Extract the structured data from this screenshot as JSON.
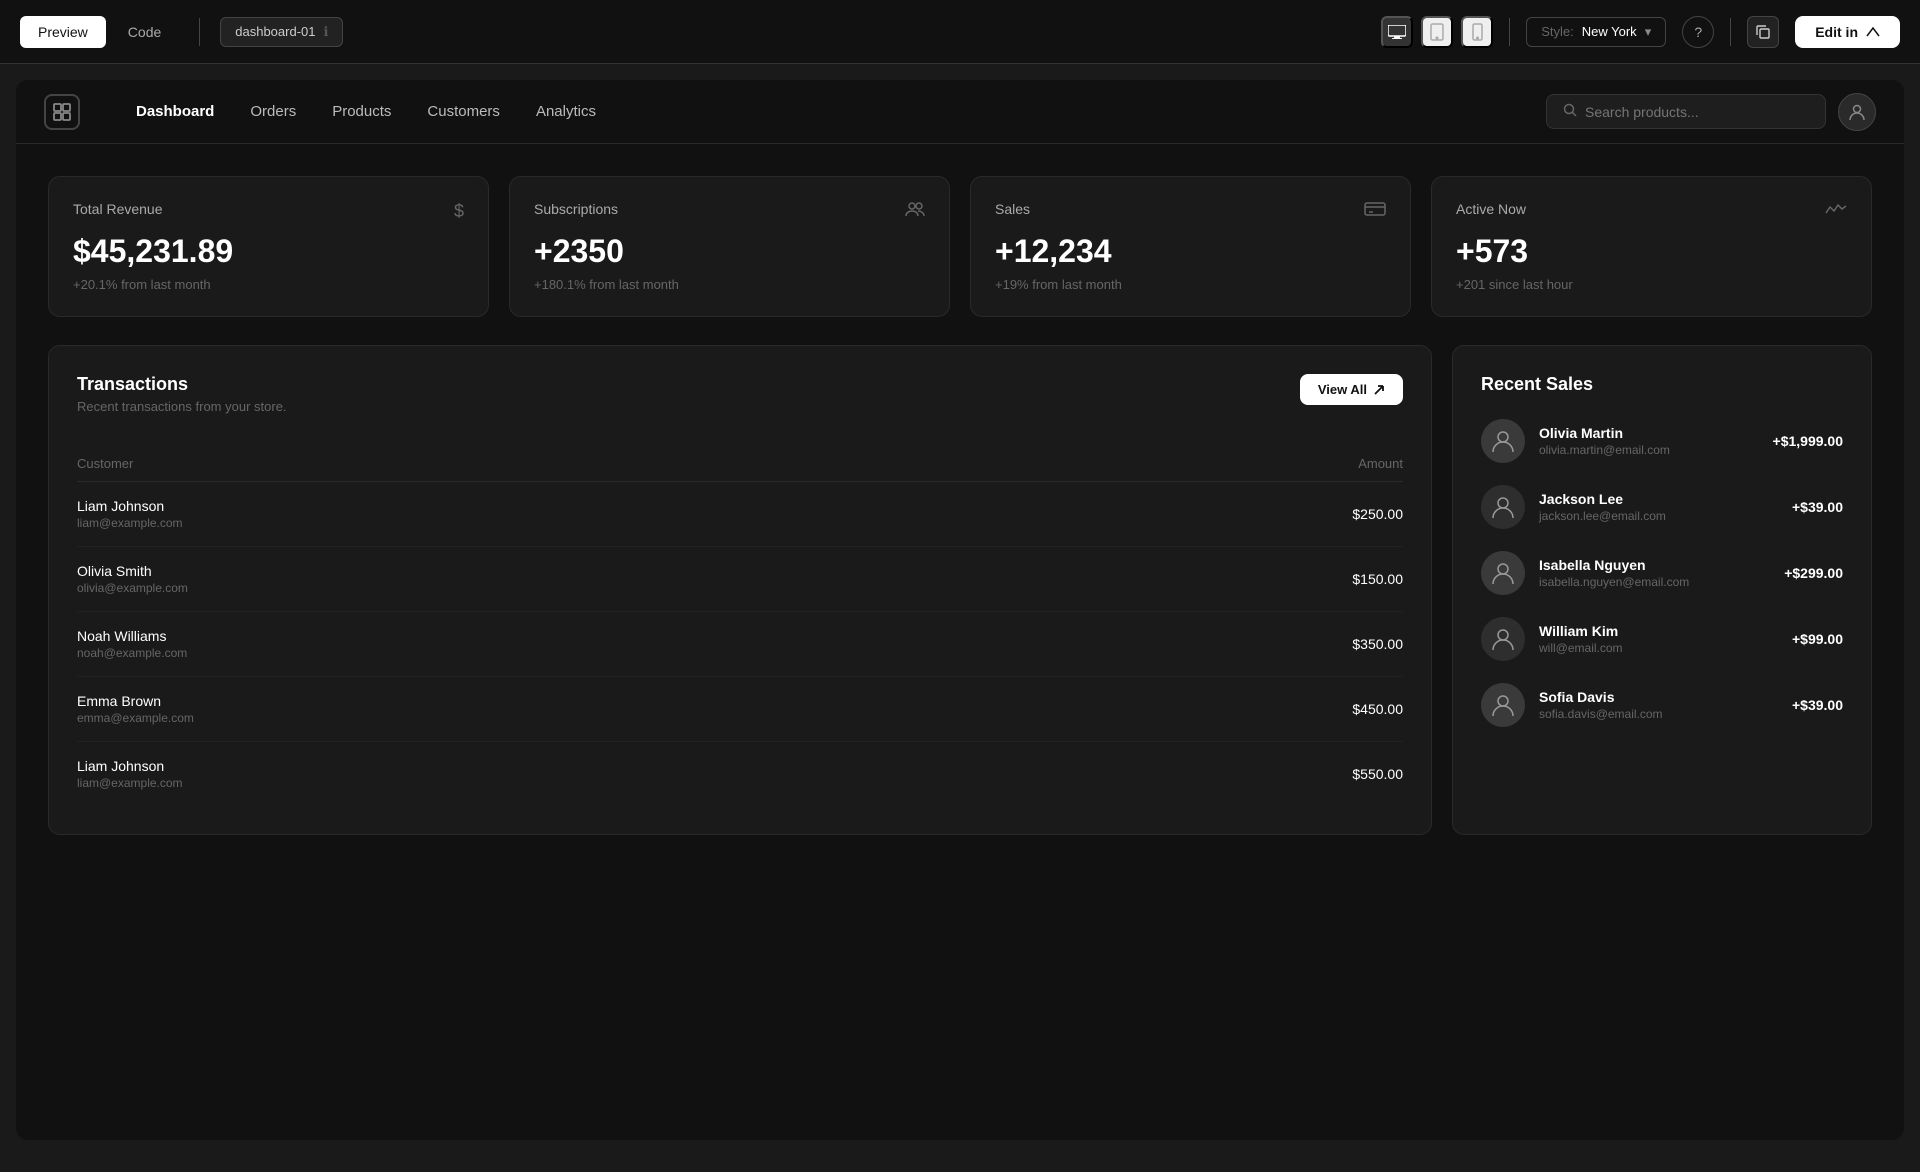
{
  "toolbar": {
    "preview_label": "Preview",
    "code_label": "Code",
    "dashboard_name": "dashboard-01",
    "style_label": "Style:",
    "style_value": "New York",
    "edit_label": "Edit in",
    "device_desktop": "🖥",
    "device_tablet": "⬜",
    "device_mobile": "📱"
  },
  "nav": {
    "logo_icon": "🗂",
    "items": [
      {
        "label": "Dashboard",
        "active": true
      },
      {
        "label": "Orders",
        "active": false
      },
      {
        "label": "Products",
        "active": false
      },
      {
        "label": "Customers",
        "active": false
      },
      {
        "label": "Analytics",
        "active": false
      }
    ],
    "search_placeholder": "Search products...",
    "user_icon": "👤"
  },
  "stats": [
    {
      "title": "Total Revenue",
      "value": "$45,231.89",
      "sub": "+20.1% from last month",
      "icon": "$"
    },
    {
      "title": "Subscriptions",
      "value": "+2350",
      "sub": "+180.1% from last month",
      "icon": "👥"
    },
    {
      "title": "Sales",
      "value": "+12,234",
      "sub": "+19% from last month",
      "icon": "💳"
    },
    {
      "title": "Active Now",
      "value": "+573",
      "sub": "+201 since last hour",
      "icon": "📈"
    }
  ],
  "transactions": {
    "title": "Transactions",
    "subtitle": "Recent transactions from your store.",
    "view_all_label": "View All",
    "columns": {
      "customer": "Customer",
      "amount": "Amount"
    },
    "rows": [
      {
        "name": "Liam Johnson",
        "email": "liam@example.com",
        "amount": "$250.00"
      },
      {
        "name": "Olivia Smith",
        "email": "olivia@example.com",
        "amount": "$150.00"
      },
      {
        "name": "Noah Williams",
        "email": "noah@example.com",
        "amount": "$350.00"
      },
      {
        "name": "Emma Brown",
        "email": "emma@example.com",
        "amount": "$450.00"
      },
      {
        "name": "Liam Johnson",
        "email": "liam@example.com",
        "amount": "$550.00"
      }
    ]
  },
  "recent_sales": {
    "title": "Recent Sales",
    "items": [
      {
        "name": "Olivia Martin",
        "email": "olivia.martin@email.com",
        "amount": "+$1,999.00",
        "avatar": "👩"
      },
      {
        "name": "Jackson Lee",
        "email": "jackson.lee@email.com",
        "amount": "+$39.00",
        "avatar": "👨"
      },
      {
        "name": "Isabella Nguyen",
        "email": "isabella.nguyen@email.com",
        "amount": "+$299.00",
        "avatar": "👩"
      },
      {
        "name": "William Kim",
        "email": "will@email.com",
        "amount": "+$99.00",
        "avatar": "👨"
      },
      {
        "name": "Sofia Davis",
        "email": "sofia.davis@email.com",
        "amount": "+$39.00",
        "avatar": "👩"
      }
    ]
  }
}
